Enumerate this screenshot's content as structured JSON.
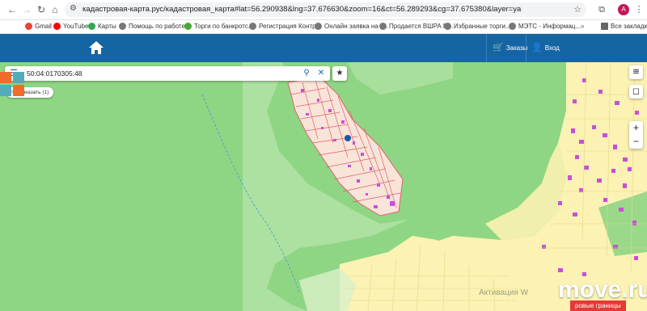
{
  "browser": {
    "url": "кадастровая-карта.рус/кадастровая_карта#lat=56.290938&lng=37.676630&zoom=16&ct=56.289293&cg=37.675380&layer=ya",
    "avatar_letter": "A",
    "bookmarks": [
      "Gmail",
      "YouTube",
      "Карты",
      "Помощь по работе...",
      "Торги по банкротс...",
      "Регистрация Контр...",
      "Онлайн заявка на з...",
      "Продается ВШРА П...",
      "Избранные торги...",
      "МЭТС - Информац...",
      "Все закладки"
    ]
  },
  "header": {
    "orders_label": "Заказы",
    "login_label": "Вход",
    "color": "#1565a3"
  },
  "search": {
    "value": "50:04:0170305:48"
  },
  "map": {
    "show_label": "показать (1)",
    "zoom_in": "+",
    "zoom_out": "−",
    "activation_text": "Активация W",
    "border_label": "ровые границы",
    "watermark": "move.ru",
    "colors": {
      "forest": "#8fd684",
      "settlement": "#fbf2b3",
      "parcel_border": "#e06070",
      "marker": "#1a5aa0"
    }
  }
}
